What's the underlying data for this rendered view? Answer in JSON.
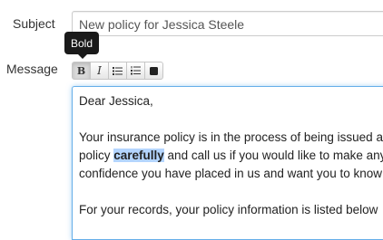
{
  "form": {
    "subject_label": "Subject",
    "subject_value": "New policy for Jessica Steele",
    "message_label": "Message"
  },
  "tooltip": {
    "text": "Bold"
  },
  "toolbar": {
    "buttons": [
      {
        "name": "bold",
        "glyph": "B",
        "icon": "bold-icon",
        "active": true
      },
      {
        "name": "italic",
        "glyph": "I",
        "icon": "italic-icon",
        "active": false
      },
      {
        "name": "bulleted-list",
        "icon": "bulleted-list-icon",
        "active": false
      },
      {
        "name": "numbered-list",
        "icon": "numbered-list-icon",
        "active": false
      },
      {
        "name": "source",
        "icon": "square-icon",
        "active": false
      }
    ]
  },
  "editor": {
    "greeting": "Dear Jessica,",
    "line1": "Your insurance policy is in the process of being issued an",
    "line2_before": "policy ",
    "line2_selected": "carefully",
    "line2_after": " and call us if you would like to make any",
    "line3": "confidence you have placed in us and want you to know",
    "line4": "For your records, your policy information is listed below"
  },
  "colors": {
    "focus_border": "#66afe9",
    "selection": "#b4d5fe",
    "tooltip_bg": "#1a1a1a"
  }
}
